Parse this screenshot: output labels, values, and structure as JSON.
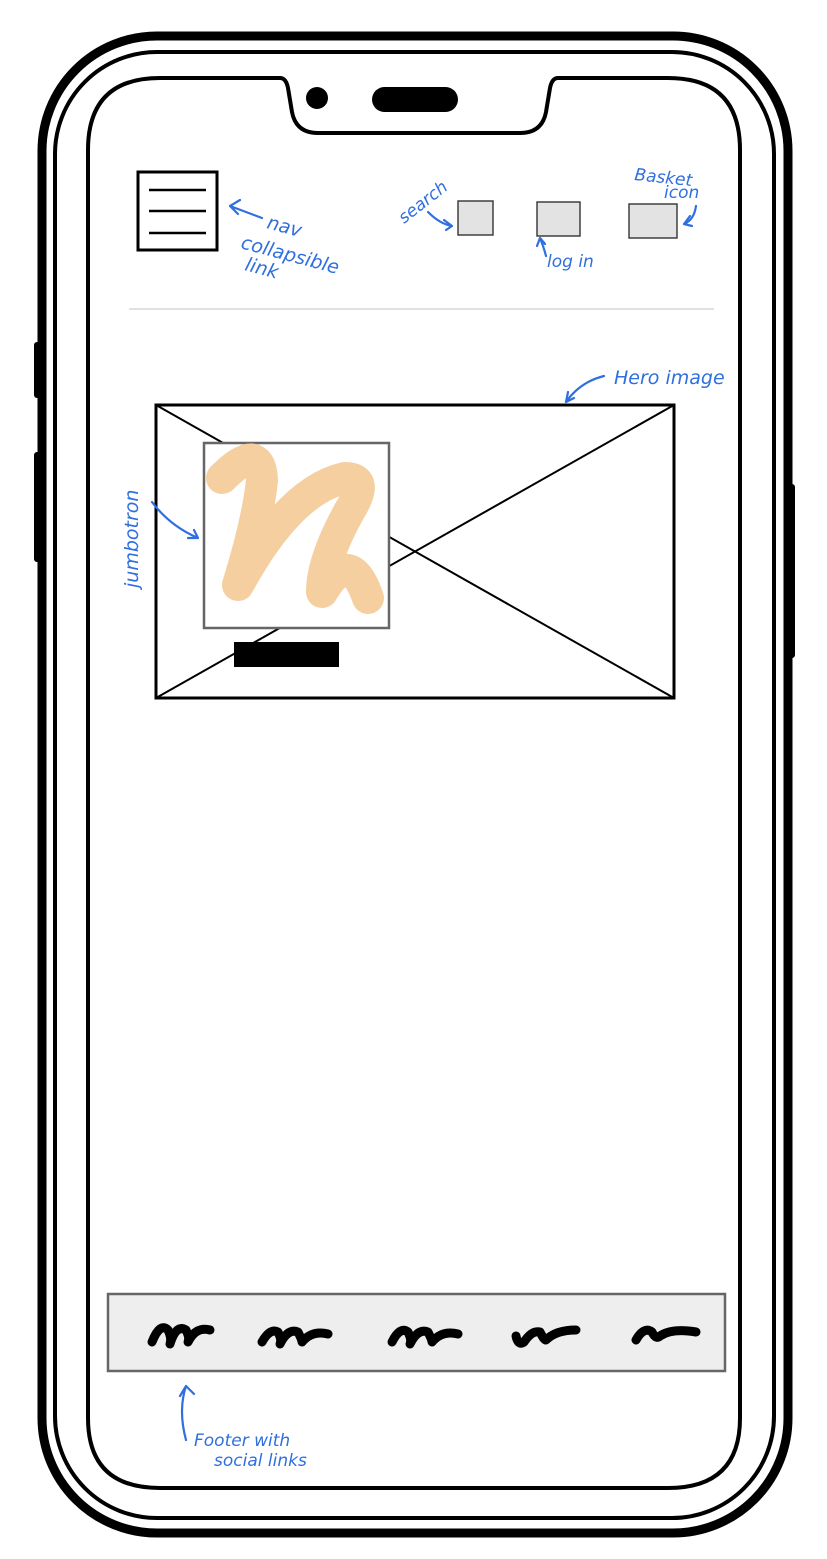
{
  "annotations": {
    "nav": [
      "nav",
      "collapsible",
      "link"
    ],
    "search": "search",
    "login": "log in",
    "basket": [
      "Basket",
      "icon"
    ],
    "hero": "Hero image",
    "jumbotron": "jumbotron",
    "footer": [
      "Footer with",
      "social links"
    ]
  },
  "colors": {
    "annotation": "#2f6fe0",
    "jumbotron_scribble": "#f5cfa0",
    "footer_bg": "#eeeeee",
    "icon_box": "#e3e3e3"
  },
  "icons": {
    "nav": "hamburger-icon",
    "search": "search-icon-placeholder",
    "login": "login-icon-placeholder",
    "basket": "basket-icon-placeholder",
    "footer_links": [
      "social-link-1",
      "social-link-2",
      "social-link-3",
      "social-link-4",
      "social-link-5"
    ]
  }
}
